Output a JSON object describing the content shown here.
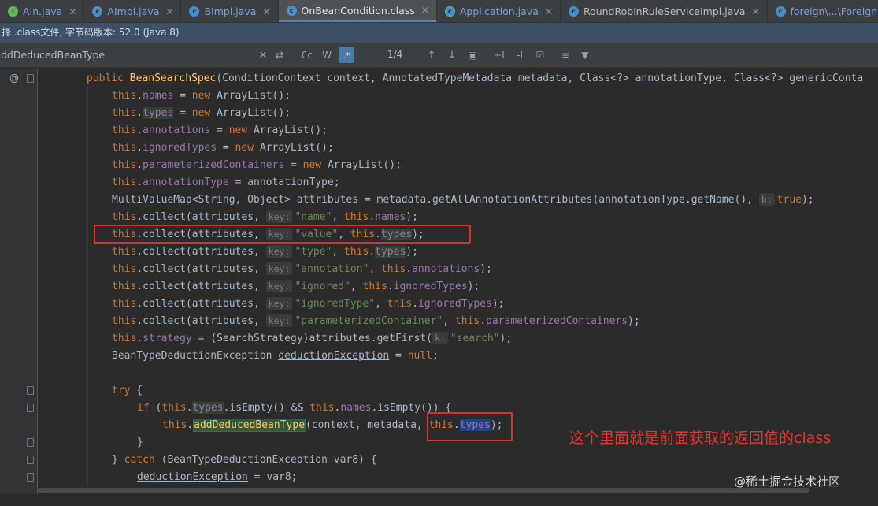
{
  "tabs": [
    {
      "label": "AIn.java",
      "icon": "interface-icon"
    },
    {
      "label": "AImpl.java",
      "icon": "class-icon"
    },
    {
      "label": "BImpl.java",
      "icon": "class-icon"
    },
    {
      "label": "OnBeanCondition.class",
      "icon": "class-file-icon",
      "active": true
    },
    {
      "label": "Application.java",
      "icon": "spring-app-icon"
    },
    {
      "label": "RoundRobinRuleServiceImpl.java",
      "icon": "class-icon"
    },
    {
      "label": "foreign\\...\\ForeignSdkValidateConf",
      "icon": "class-icon"
    }
  ],
  "info_bar": {
    "text": "择 .class文件, 字节码版本: 52.0 (Java 8)"
  },
  "find_bar": {
    "query": "ddDeducedBeanType",
    "match_count": "1/4",
    "regex_label": ".*",
    "case_label": "Cc"
  },
  "gutter": {
    "override_marker": "@"
  },
  "code": {
    "l0": {
      "kw1": "public ",
      "name": "BeanSearchSpec",
      "rest": "(ConditionContext context, AnnotatedTypeMetadata metadata, Class<?> annotationType, Class<?> genericConta"
    },
    "l1": {
      "kw": "this",
      "dot": ".",
      "fld": "names",
      "eq": " = ",
      "new": "new ",
      "rest": "ArrayList();"
    },
    "l2": {
      "kw": "this",
      "dot": ".",
      "fld": "types",
      "eq": " = ",
      "new": "new ",
      "rest": "ArrayList();"
    },
    "l3": {
      "kw": "this",
      "dot": ".",
      "fld": "annotations",
      "eq": " = ",
      "new": "new ",
      "rest": "ArrayList();"
    },
    "l4": {
      "kw": "this",
      "dot": ".",
      "fld": "ignoredTypes",
      "eq": " = ",
      "new": "new ",
      "rest": "ArrayList();"
    },
    "l5": {
      "kw": "this",
      "dot": ".",
      "fld": "parameterizedContainers",
      "eq": " = ",
      "new": "new ",
      "rest": "ArrayList();"
    },
    "l6": {
      "kw": "this",
      "dot": ".",
      "fld": "annotationType",
      "rest": " = annotationType;"
    },
    "l7": {
      "pre": "MultiValueMap<String, Object> attributes = metadata.getAllAnnotationAttributes(annotationType.getName(), ",
      "hint": "b:",
      "kw": "true",
      "end": ");"
    },
    "l8": {
      "kw": "this",
      "call": ".collect(attributes, ",
      "hint": "key:",
      "str": "\"name\"",
      "sep": ", ",
      "kw2": "this",
      "dot": ".",
      "fld": "names",
      "end": ");"
    },
    "l9": {
      "kw": "this",
      "call": ".collect(attributes, ",
      "hint": "key:",
      "str": "\"value\"",
      "sep": ", ",
      "kw2": "this",
      "dot": ".",
      "fld": "types",
      "end": ");"
    },
    "l10": {
      "kw": "this",
      "call": ".collect(attributes, ",
      "hint": "key:",
      "str": "\"type\"",
      "sep": ", ",
      "kw2": "this",
      "dot": ".",
      "fld": "types",
      "end": ");"
    },
    "l11": {
      "kw": "this",
      "call": ".collect(attributes, ",
      "hint": "key:",
      "str": "\"annotation\"",
      "sep": ", ",
      "kw2": "this",
      "dot": ".",
      "fld": "annotations",
      "end": ");"
    },
    "l12": {
      "kw": "this",
      "call": ".collect(attributes, ",
      "hint": "key:",
      "str": "\"ignored\"",
      "sep": ", ",
      "kw2": "this",
      "dot": ".",
      "fld": "ignoredTypes",
      "end": ");"
    },
    "l13": {
      "kw": "this",
      "call": ".collect(attributes, ",
      "hint": "key:",
      "str": "\"ignoredType\"",
      "sep": ", ",
      "kw2": "this",
      "dot": ".",
      "fld": "ignoredTypes",
      "end": ");"
    },
    "l14": {
      "kw": "this",
      "call": ".collect(attributes, ",
      "hint": "key:",
      "str": "\"parameterizedContainer\"",
      "sep": ", ",
      "kw2": "this",
      "dot": ".",
      "fld": "parameterizedContainers",
      "end": ");"
    },
    "l15": {
      "kw": "this",
      "dot": ".",
      "fld": "strategy",
      "rest": " = (SearchStrategy)attributes.getFirst(",
      "hint": "k:",
      "str": "\"search\"",
      "end": ");"
    },
    "l16": {
      "pre": "BeanTypeDeductionException ",
      "var": "deductionException",
      "eq": " = ",
      "kw": "null",
      "end": ";"
    },
    "l18": {
      "kw": "try",
      "rest": " {"
    },
    "l19": {
      "kw": "if",
      "p1": " (",
      "kw2": "this",
      "dot": ".",
      "fld": "types",
      "mid": ".isEmpty() && ",
      "kw3": "this",
      "dot2": ".",
      "fld2": "names",
      "end": ".isEmpty()) {"
    },
    "l20": {
      "kw": "this",
      "dot": ".",
      "mth": "addDeducedBeanType",
      "rest": "(context, metadata, ",
      "kw2": "this",
      "dot2": ".",
      "fld": "types",
      "end": ");"
    },
    "l21": {
      "text": "}"
    },
    "l22": {
      "p1": "} ",
      "kw": "catch",
      "rest": " (BeanTypeDeductionException var8) {"
    },
    "l23": {
      "var": "deductionException",
      "rest": " = var8;"
    }
  },
  "annotation_text": "这个里面就是前面获取的返回值的class",
  "watermark": "@稀土掘金技术社区",
  "colors": {
    "annotation_red": "#e0302a",
    "keyword": "#cc7832",
    "field": "#9876aa",
    "string": "#6a8759",
    "method": "#ffc66d"
  }
}
